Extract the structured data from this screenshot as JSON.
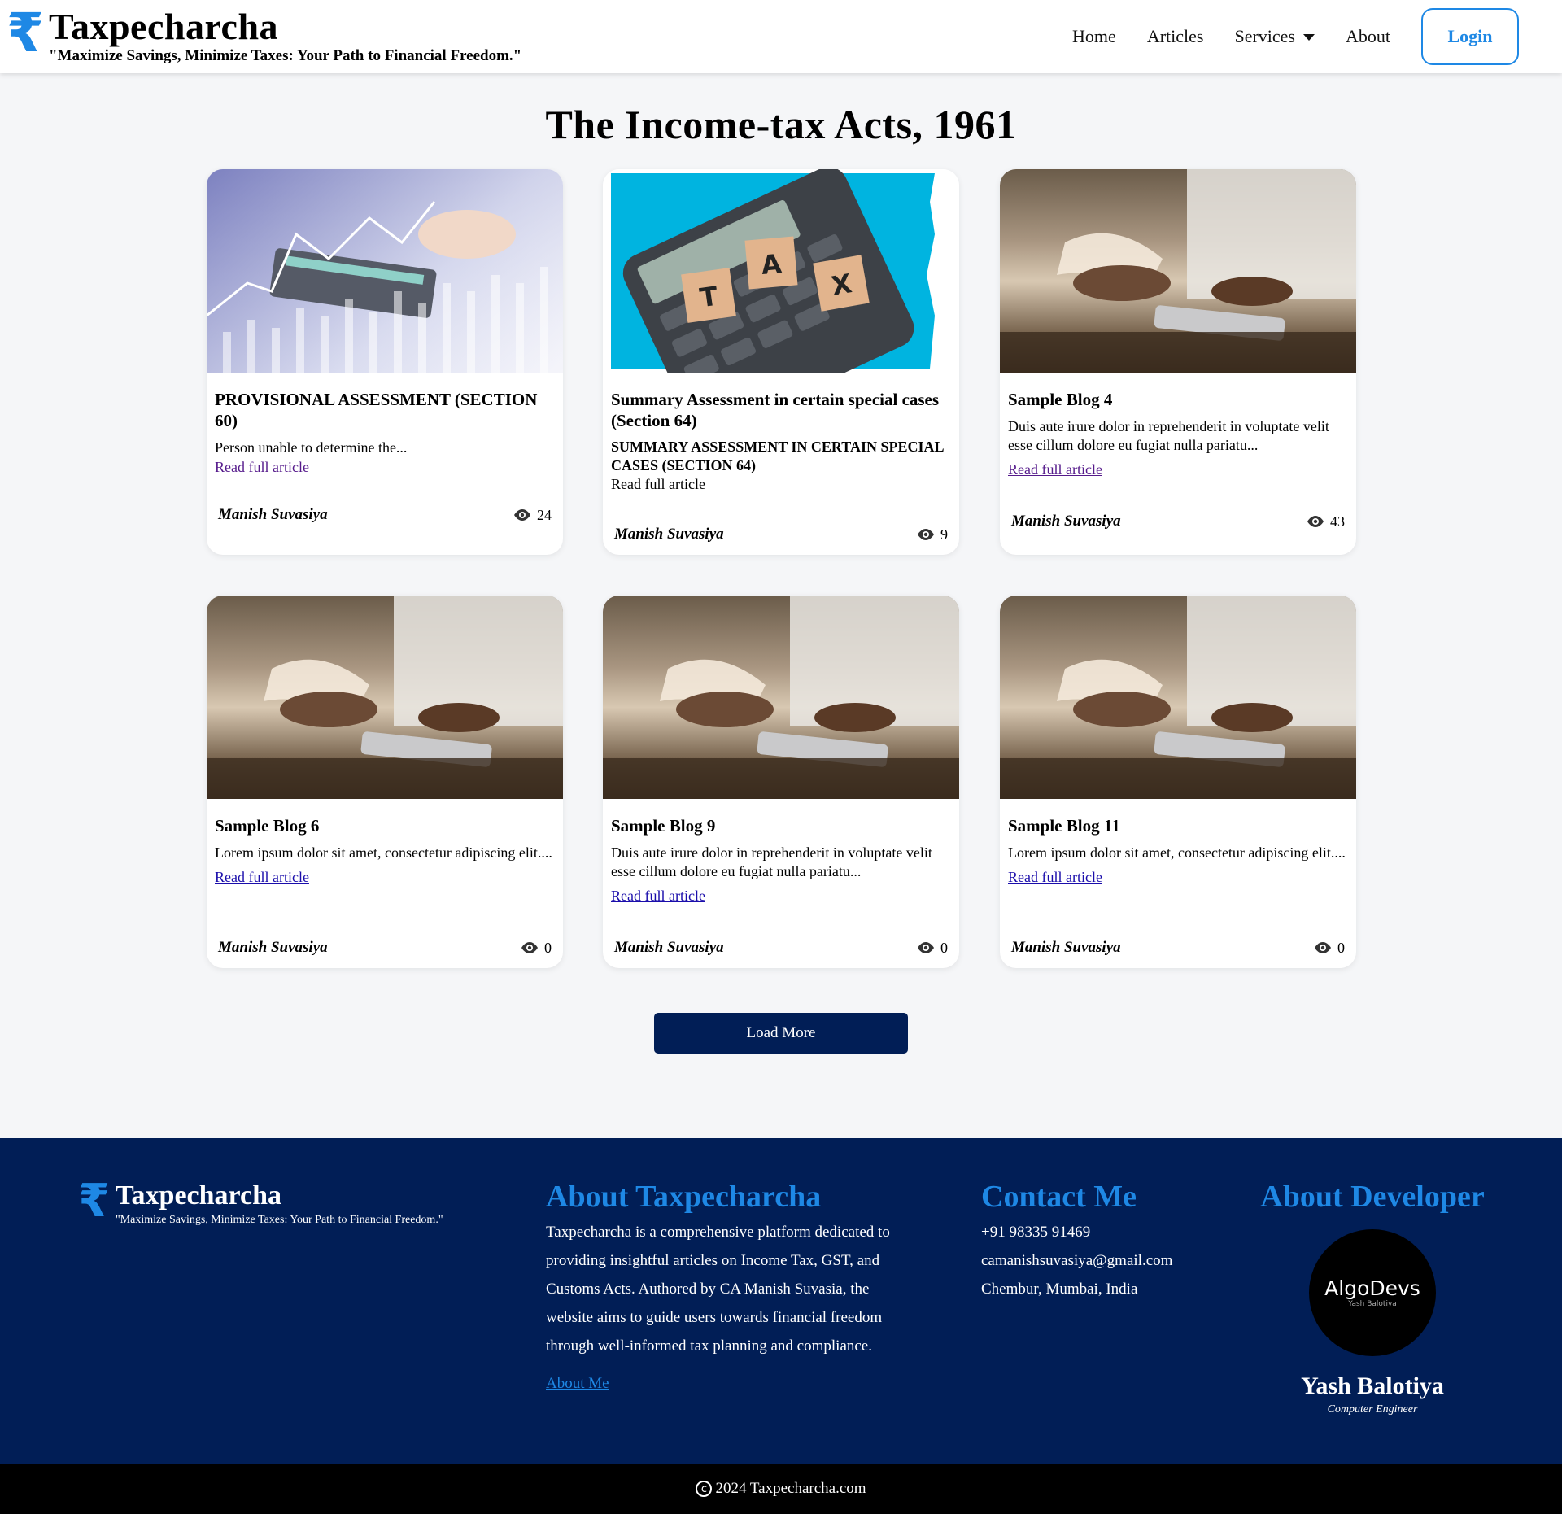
{
  "header": {
    "brand_name": "Taxpecharcha",
    "tagline": "\"Maximize Savings, Minimize Taxes: Your Path to Financial Freedom.\"",
    "nav": {
      "home": "Home",
      "articles": "Articles",
      "services": "Services",
      "about": "About"
    },
    "login_label": "Login"
  },
  "page_title": "The Income-tax Acts, 1961",
  "cards": [
    {
      "title": "PROVISIONAL ASSESSMENT (SECTION 60)",
      "excerpt": "Person unable to determine the...",
      "link": "Read full article",
      "author": "Manish Suvasiya",
      "views": "24"
    },
    {
      "title": "Summary Assessment in certain special cases (Section 64)",
      "subtitle": "SUMMARY ASSESSMENT IN CERTAIN SPECIAL CASES (SECTION 64)",
      "link": "Read full article",
      "author": "Manish Suvasiya",
      "views": "9"
    },
    {
      "title": "Sample Blog 4",
      "excerpt": "Duis aute irure dolor in reprehenderit in voluptate velit esse cillum dolore eu fugiat nulla pariatu...",
      "link": "Read full article",
      "author": "Manish Suvasiya",
      "views": "43"
    },
    {
      "title": "Sample Blog 6",
      "excerpt": "Lorem ipsum dolor sit amet, consectetur adipiscing elit....",
      "link": "Read full article",
      "author": "Manish Suvasiya",
      "views": "0"
    },
    {
      "title": "Sample Blog 9",
      "excerpt": "Duis aute irure dolor in reprehenderit in voluptate velit esse cillum dolore eu fugiat nulla pariatu...",
      "link": "Read full article",
      "author": "Manish Suvasiya",
      "views": "0"
    },
    {
      "title": "Sample Blog 11",
      "excerpt": "Lorem ipsum dolor sit amet, consectetur adipiscing elit....",
      "link": "Read full article",
      "author": "Manish Suvasiya",
      "views": "0"
    }
  ],
  "tax_tiles": [
    "T",
    "A",
    "X"
  ],
  "load_more_label": "Load More",
  "footer": {
    "brand_name": "Taxpecharcha",
    "tagline": "\"Maximize Savings, Minimize Taxes: Your Path to Financial Freedom.\"",
    "about_heading": "About Taxpecharcha",
    "about_text": "Taxpecharcha is a comprehensive platform dedicated to providing insightful articles on Income Tax, GST, and Customs Acts. Authored by CA Manish Suvasia, the website aims to guide users towards financial freedom through well-informed tax planning and compliance.",
    "about_link": "About Me",
    "contact_heading": "Contact Me",
    "phone": "+91 98335 91469",
    "email": "camanishsuvasiya@gmail.com",
    "location": "Chembur, Mumbai, India",
    "dev_heading": "About Developer",
    "dev_logo_main": "AlgoDevs",
    "dev_logo_sub": "Yash Balotiya",
    "dev_name": "Yash Balotiya",
    "dev_role": "Computer Engineer"
  },
  "copyright": "2024 Taxpecharcha.com",
  "colors": {
    "accent": "#1e88e5",
    "navy": "#011e56",
    "background": "#f5f6f8"
  }
}
